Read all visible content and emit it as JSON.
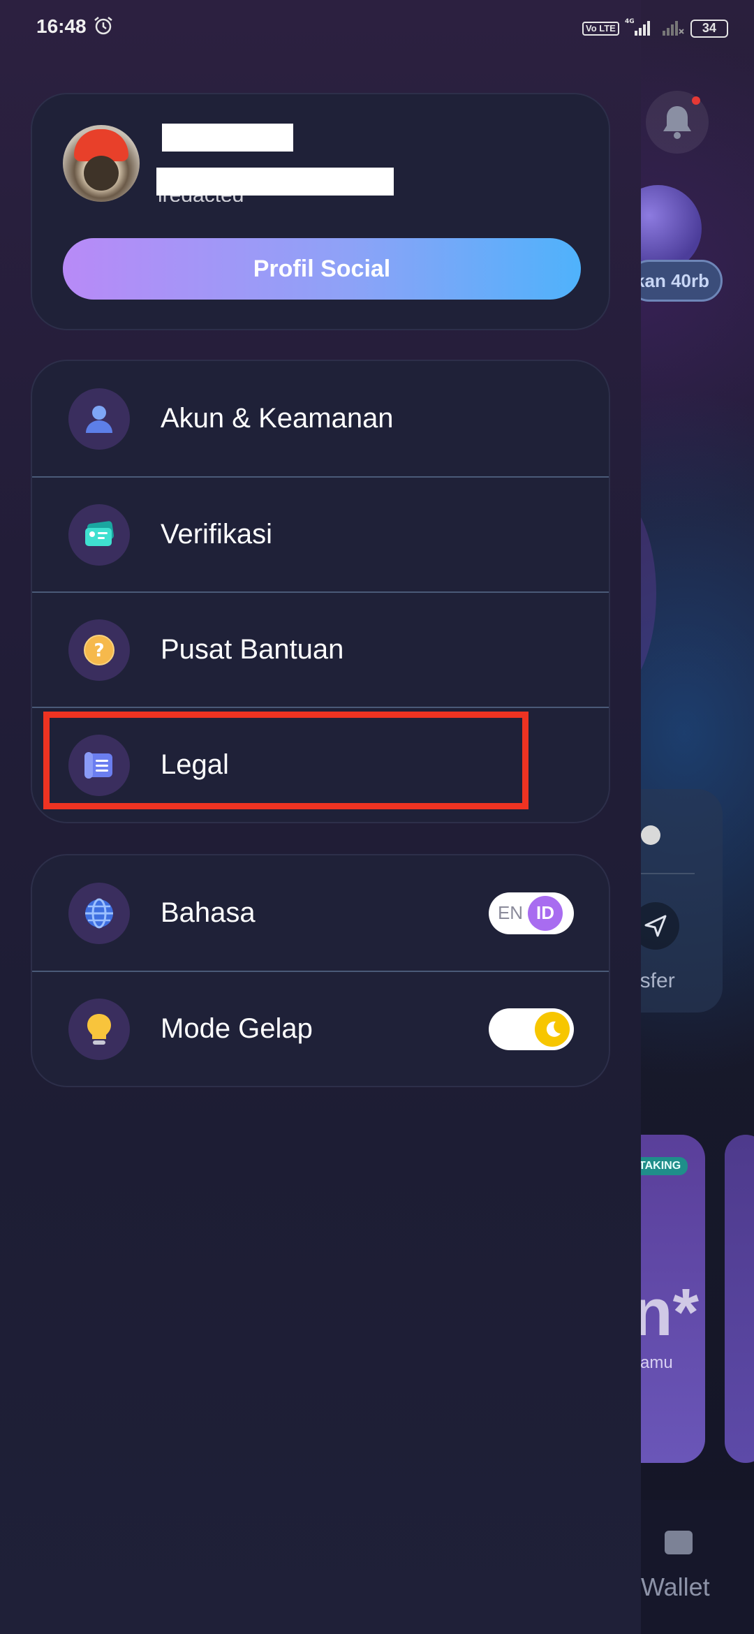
{
  "status_bar": {
    "time": "16:48",
    "volte": "Vo LTE",
    "network": "4G",
    "battery": "34"
  },
  "profile": {
    "button_label": "Profil Social",
    "handle_partial": "iredacted"
  },
  "menu_group_1": {
    "items": [
      {
        "label": "Akun & Keamanan",
        "icon": "user-icon"
      },
      {
        "label": "Verifikasi",
        "icon": "id-card-icon"
      },
      {
        "label": "Pusat Bantuan",
        "icon": "help-icon"
      },
      {
        "label": "Legal",
        "icon": "document-icon"
      }
    ]
  },
  "menu_group_2": {
    "items": [
      {
        "label": "Bahasa",
        "icon": "globe-icon",
        "toggle": {
          "left": "EN",
          "right": "ID",
          "selected": "ID"
        }
      },
      {
        "label": "Mode Gelap",
        "icon": "lightbulb-icon",
        "toggle_state": "on"
      }
    ]
  },
  "background_app": {
    "pill_label": "kan 40rb",
    "transfer_label": "nsfer",
    "promo_badge": "TAKING",
    "promo_big": "n*",
    "promo_small": "kamu",
    "nav_label": "Wallet"
  },
  "colors": {
    "accent_purple": "#a86cf0",
    "highlight_red": "#ee3322",
    "button_gradient_start": "#b88af7",
    "button_gradient_end": "#4fb2fb",
    "dark_toggle_knob": "#f7c600"
  }
}
